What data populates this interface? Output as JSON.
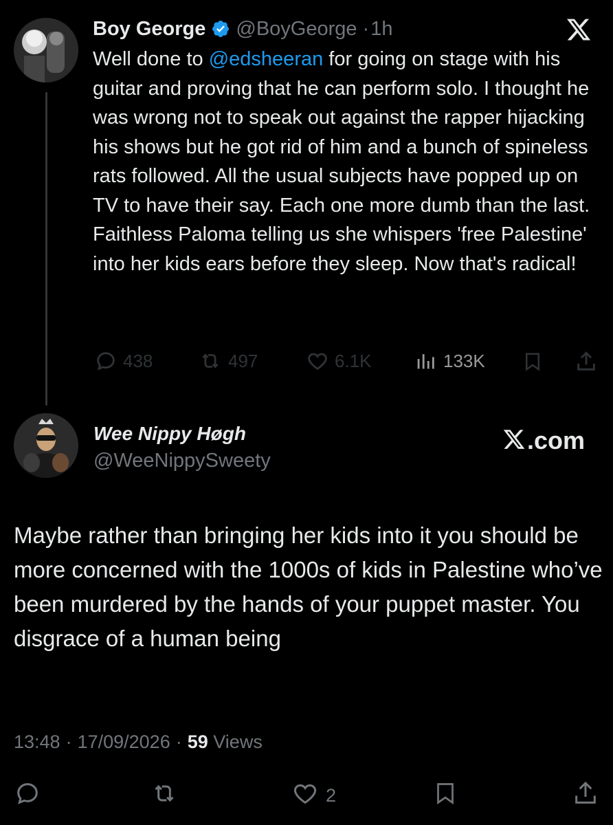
{
  "quoted_tweet": {
    "author_name": "Boy George",
    "handle": "@BoyGeorge",
    "separator": "·",
    "time": "1h",
    "text_before_mention": "Well done to ",
    "mention": "@edsheeran",
    "text_after_mention": " for going on stage with his guitar and proving that he can perform solo. I thought he was wrong not to speak out against the rapper hijacking his shows but he got rid of him and a bunch of spineless rats followed. All the usual subjects have popped up on TV to have their say. Each one more dumb than the last. Faithless Paloma telling us she whispers 'free Palestine' into her kids ears before they sleep. Now that's radical!",
    "replies": "438",
    "reposts": "497",
    "likes": "6.1K",
    "views": "133K"
  },
  "reply_tweet": {
    "author_name": "Wee Nippy Høgh",
    "handle": "@WeeNippySweety",
    "brand": "X.com",
    "text": "Maybe rather than bringing her kids into it you should be more concerned with the 1000s of kids in Palestine who’ve been murdered by the hands of your puppet master. You disgrace of a human being",
    "time": "13:48",
    "date": "17/09/2026",
    "separator": "·",
    "views_count": "59",
    "views_label": "Views",
    "likes": "2"
  },
  "colors": {
    "background": "#000000",
    "text": "#e7e9ea",
    "muted": "#71767b",
    "link": "#1d9bf0",
    "verified": "#1d9bf0"
  },
  "icons": [
    "verified-badge-icon",
    "x-logo-icon",
    "reply-icon",
    "repost-icon",
    "like-icon",
    "views-icon",
    "bookmark-icon",
    "share-icon"
  ]
}
